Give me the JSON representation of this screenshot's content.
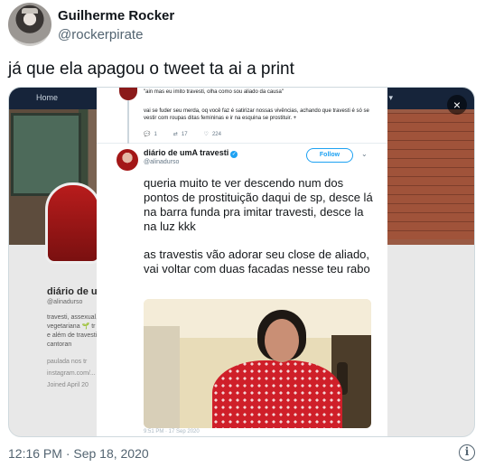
{
  "tweet": {
    "display_name": "Guilherme Rocker",
    "handle": "@rockerpirate",
    "text": "já que ela apagou o tweet ta ai a print",
    "timestamp": "12:16 PM · Sep 18, 2020"
  },
  "media": {
    "background": {
      "nav_home": "Home",
      "nav_login": "Log in ▾",
      "profile_name": "diário de ur",
      "profile_handle": "@alinadurso",
      "bio_lines": [
        "travesti, assexual,",
        "vegetariana 🌱 tr",
        "e além de travesti",
        "cantoran"
      ],
      "meta_lines": [
        "paulada nos tr",
        "instagram.com/...",
        "Joined April 20"
      ]
    },
    "close_icon": "×",
    "parent_tweet": {
      "quote": "\"ain mas eu imito travesti, olha como sou aliado da causa\"",
      "body": "vai se fuder seu merda, oq você faz é satirizar nossas vivências, achando que travesti é só se vestir com roupas ditas femininas e ir na esquina se prostituir. +",
      "replies": "1",
      "retweets": "17",
      "likes": "224"
    },
    "main_tweet": {
      "name": "diário de umA travesti",
      "handle": "@alinadurso",
      "follow_label": "Follow",
      "paragraph_1": "queria muito te ver descendo num dos pontos de prostituição daqui de sp, desce lá na barra funda pra imitar travesti, desce la na luz kkk",
      "paragraph_2": "as travestis vão adorar seu close de aliado, vai voltar com duas facadas nesse teu rabo",
      "date": "9:51 PM · 17 Sep 2020"
    }
  },
  "icons": {
    "reply": "reply-icon",
    "retweet": "retweet-icon",
    "like": "heart-icon",
    "verified": "verified-badge-icon",
    "chevron": "chevron-down-icon",
    "info": "info-icon",
    "close": "close-icon"
  },
  "colors": {
    "accent": "#1da1f2",
    "text_primary": "#0f1419",
    "text_secondary": "#536471"
  }
}
